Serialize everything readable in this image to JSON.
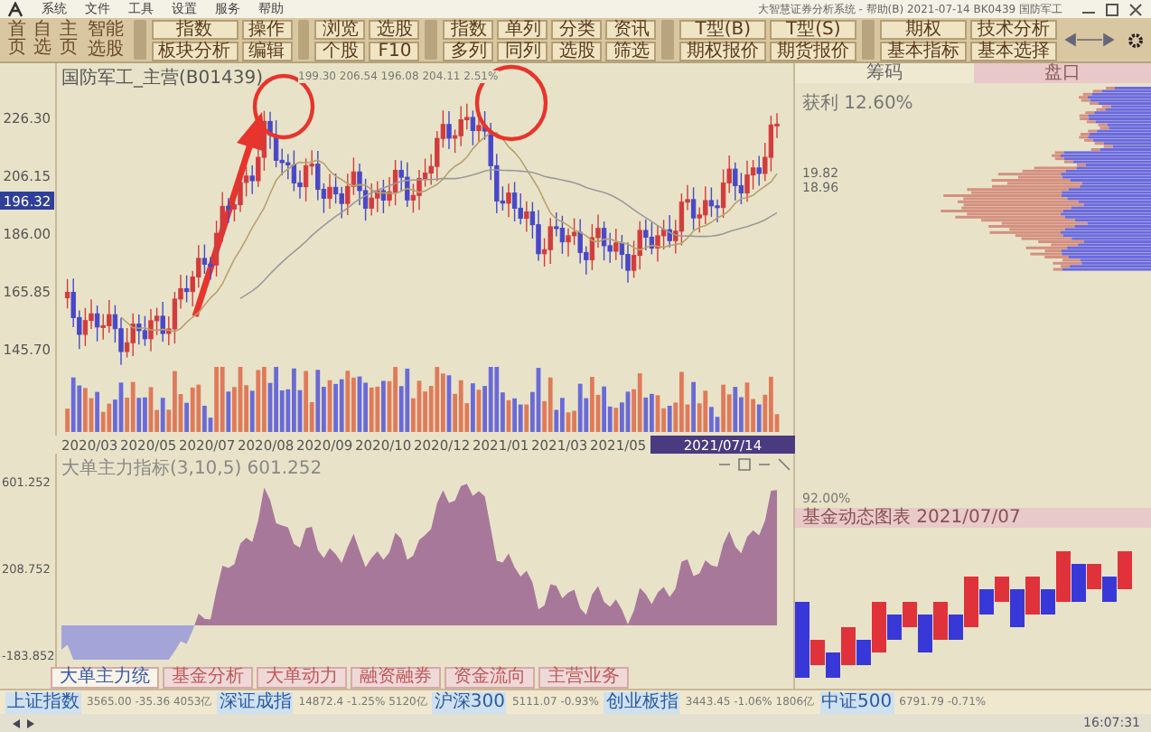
{
  "window": {
    "title": "大智慧证券分析系统 - 帮助(B) 2021-07-14 BK0439 国防军工"
  },
  "menu": [
    "系统",
    "文件",
    "工具",
    "设置",
    "服务",
    "帮助"
  ],
  "toolbar": {
    "nav": [
      "首页",
      "自选",
      "主页"
    ],
    "smart": "智能选股",
    "groups": [
      [
        "指数",
        "操作",
        "板块分析",
        "编辑"
      ],
      [
        "浏览",
        "选股",
        "个股",
        "F10"
      ],
      [
        "指数",
        "单列",
        "分类",
        "资讯",
        "多列",
        "同列",
        "选股",
        "筛选"
      ],
      [
        "T型(B)",
        "T型(S)",
        "期权报价",
        "期货报价"
      ],
      [
        "期权",
        "技术分析",
        "基本指标",
        "基本选择"
      ]
    ]
  },
  "chart": {
    "title": "国防军工_主营(B01439)",
    "info": "199.30 206.54 196.08 204.11 2.51%",
    "price_ticks": [
      "226.30",
      "206.15",
      "186.00",
      "165.85",
      "145.70"
    ],
    "current_price": "196.32",
    "dates": [
      "2020/03",
      "2020/05",
      "2020/07",
      "2020/08",
      "2020/09",
      "2020/10",
      "2020/12",
      "2021/01",
      "2021/03",
      "2021/05"
    ],
    "date_cursor": "2021/07/14"
  },
  "indicator": {
    "title": "大单主力指标(3,10,5) 601.252",
    "ticks": [
      "601.252",
      "208.752",
      "-183.852"
    ]
  },
  "right_panel": {
    "tabs": [
      {
        "label": "筹码",
        "selected": true
      },
      {
        "label": "盘口",
        "selected": false
      }
    ],
    "profit": "获利 12.60%",
    "levels": [
      "19.82",
      "18.96"
    ],
    "ratio": "92.00%",
    "renko_title": "基金动态图表 2021/07/07"
  },
  "bottom_tabs": [
    {
      "label": "大单主力统",
      "selected": true
    },
    {
      "label": "基金分析",
      "selected": false
    },
    {
      "label": "大单动力",
      "selected": false
    },
    {
      "label": "融资融券",
      "selected": false
    },
    {
      "label": "资金流向",
      "selected": false
    },
    {
      "label": "主营业务",
      "selected": false
    }
  ],
  "status": [
    {
      "label": "上证指数",
      "values": "3565.00 -35.36 4053亿"
    },
    {
      "label": "深证成指",
      "values": "14872.4 -1.25% 5120亿"
    },
    {
      "label": "沪深300",
      "values": "5111.07 -0.93%"
    },
    {
      "label": "创业板指",
      "values": "3443.45 -1.06% 1806亿"
    },
    {
      "label": "中证500",
      "values": "6791.79 -0.71%"
    }
  ],
  "clock": "16:07:31"
}
